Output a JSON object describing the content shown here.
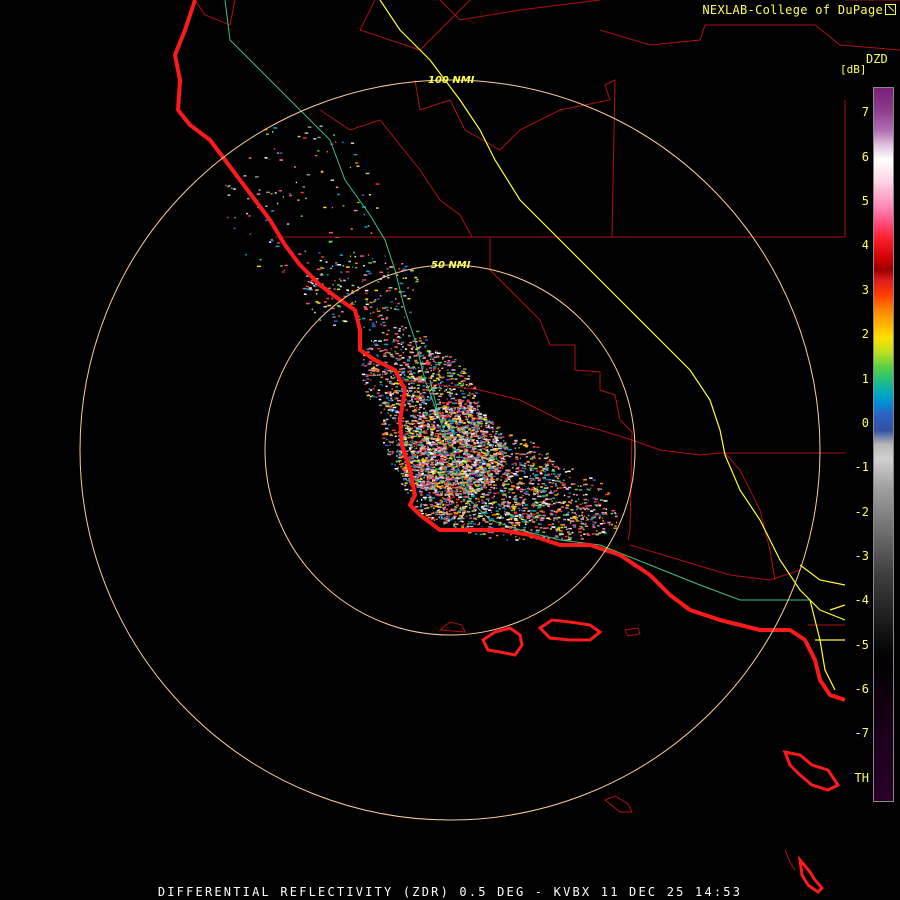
{
  "credit": "NEXLAB-College of DuPage",
  "product": {
    "title": "DIFFERENTIAL REFLECTIVITY (ZDR) 0.5 DEG - KVBX 11 DEC 25 14:53"
  },
  "legend": {
    "code": "DZD",
    "unit": "[dB]",
    "ticks": [
      "7",
      "6",
      "5",
      "4",
      "3",
      "2",
      "1",
      "0",
      "-1",
      "-2",
      "-3",
      "-4",
      "-5",
      "-6",
      "-7",
      "TH"
    ]
  },
  "range_rings": [
    {
      "label": "50 NMI",
      "range_nmi": 50
    },
    {
      "label": "100 NMI",
      "range_nmi": 100
    }
  ],
  "colors": {
    "coastline": "#ff1a1a",
    "county_lines": "#b01010",
    "interstate": "#ffff33",
    "highway": "#40c080",
    "range_ring": "#ffcc99",
    "label_text": "#ffff55"
  }
}
